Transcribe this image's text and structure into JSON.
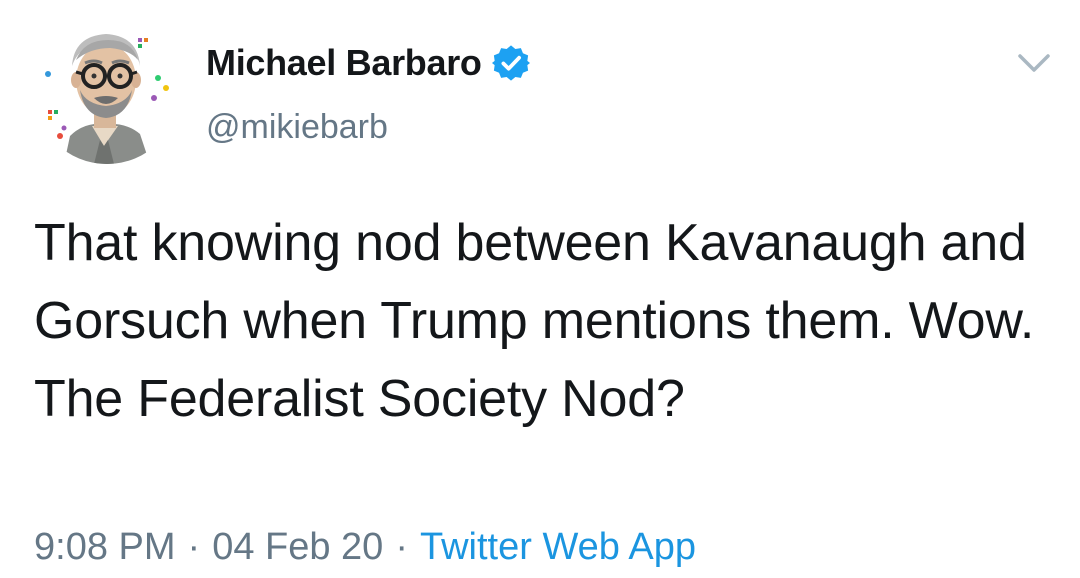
{
  "author": {
    "display_name": "Michael Barbaro",
    "handle": "@mikiebarb",
    "verified": true,
    "avatar_icon": "cartoon-portrait-avatar"
  },
  "tweet": {
    "text": "That knowing nod between Kavanaugh and Gorsuch when Trump mentions them. Wow. The Federalist Society Nod?",
    "time": "9:08 PM",
    "separator": "·",
    "date": "04 Feb 20",
    "source": "Twitter Web App"
  },
  "icons": {
    "verified": "verified-badge-icon",
    "menu": "chevron-down-icon"
  },
  "colors": {
    "text": "#14171a",
    "secondary": "#657786",
    "link": "#1b95e0",
    "verified": "#1da1f2"
  }
}
